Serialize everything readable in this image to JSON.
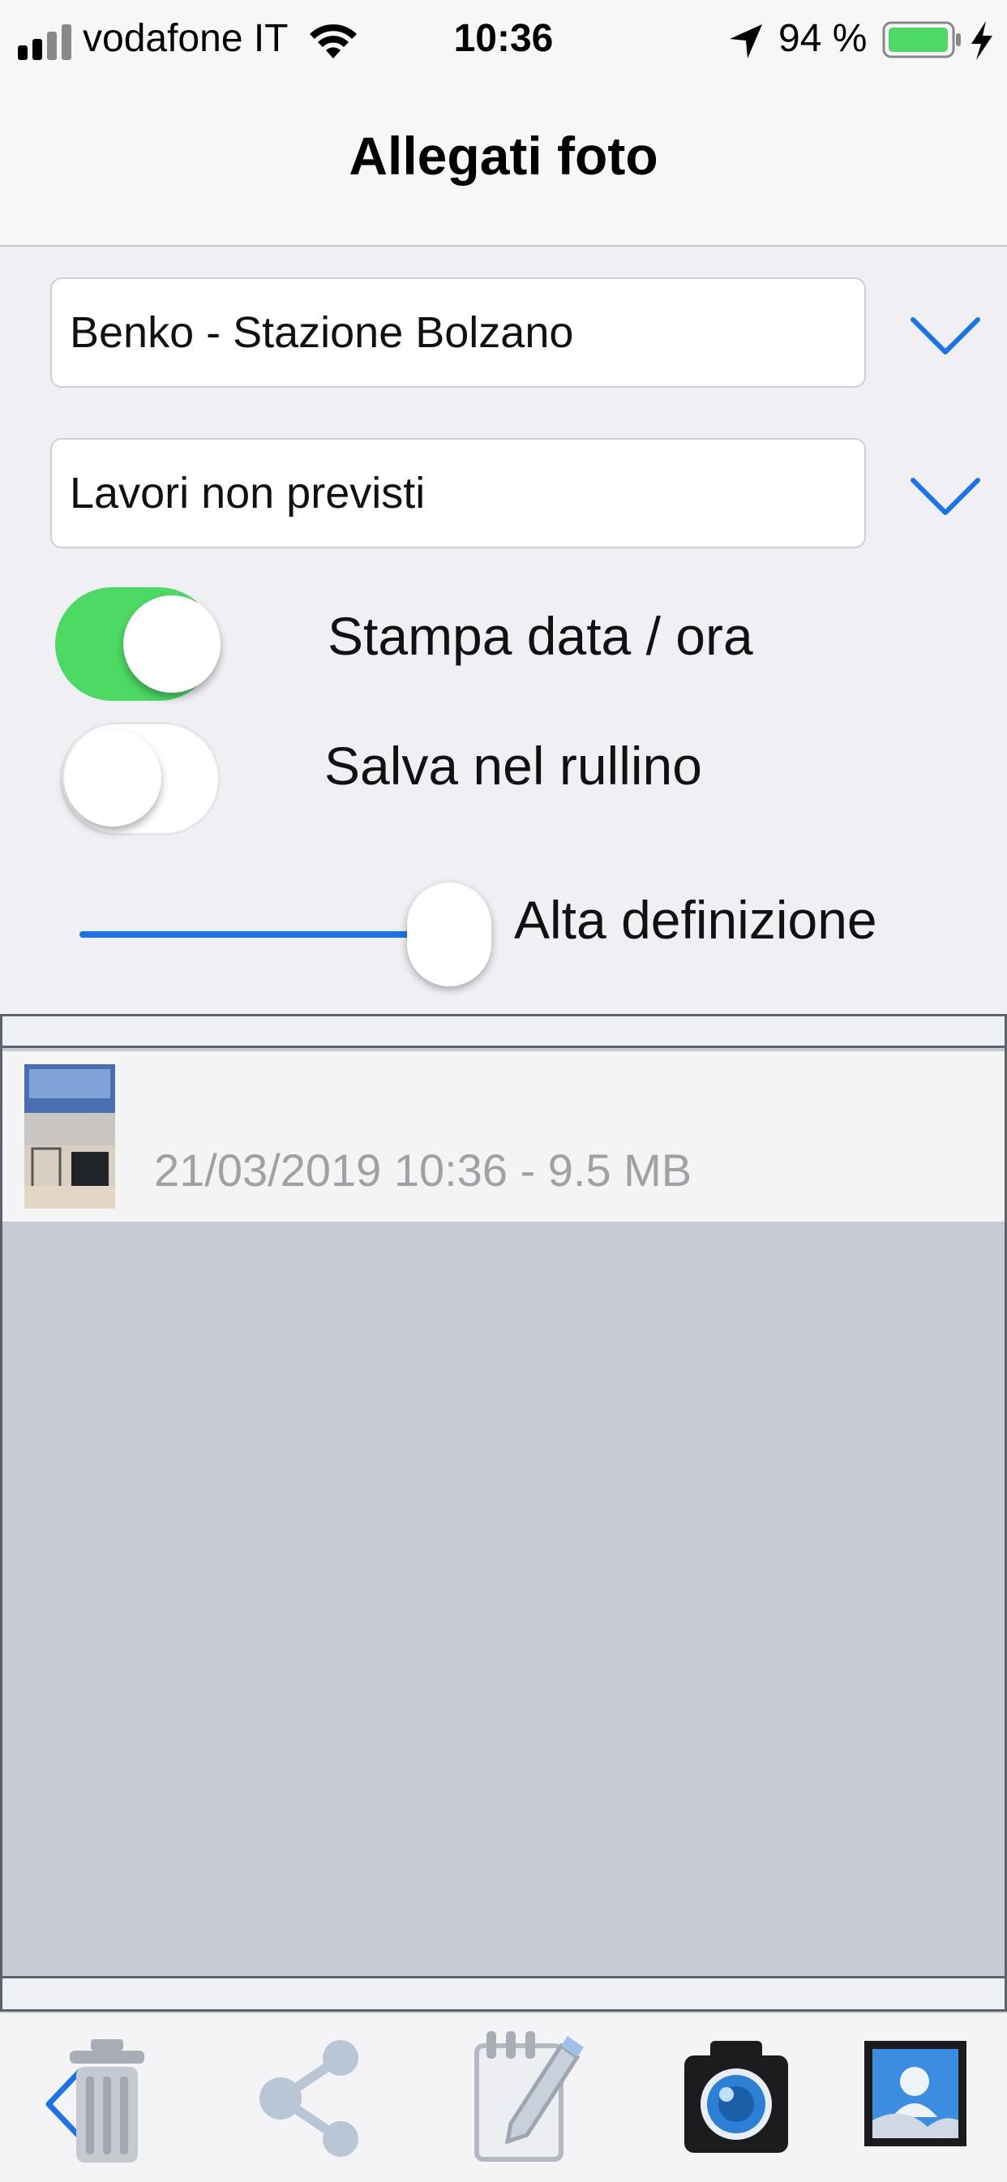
{
  "status_bar": {
    "carrier": "vodafone IT",
    "time": "10:36",
    "battery_percent": "94 %"
  },
  "nav": {
    "title": "Allegati foto"
  },
  "form": {
    "location_select": {
      "value": "Benko - Stazione Bolzano"
    },
    "category_select": {
      "value": "Lavori non previsti"
    },
    "print_datetime": {
      "label": "Stampa data / ora",
      "on": true
    },
    "save_to_roll": {
      "label": "Salva nel rullino",
      "on": false
    },
    "quality": {
      "label": "Alta definizione",
      "level": 1.0
    }
  },
  "attachments": [
    {
      "meta": "21/03/2019 10:36  - 9.5 MB"
    }
  ],
  "toolbar": {
    "items": [
      "back-icon",
      "trash-icon",
      "share-icon",
      "edit-note-icon",
      "camera-icon",
      "gallery-icon"
    ]
  },
  "colors": {
    "accent": "#1a73e8",
    "toggle_on": "#4cd964",
    "battery": "#4cd964"
  }
}
